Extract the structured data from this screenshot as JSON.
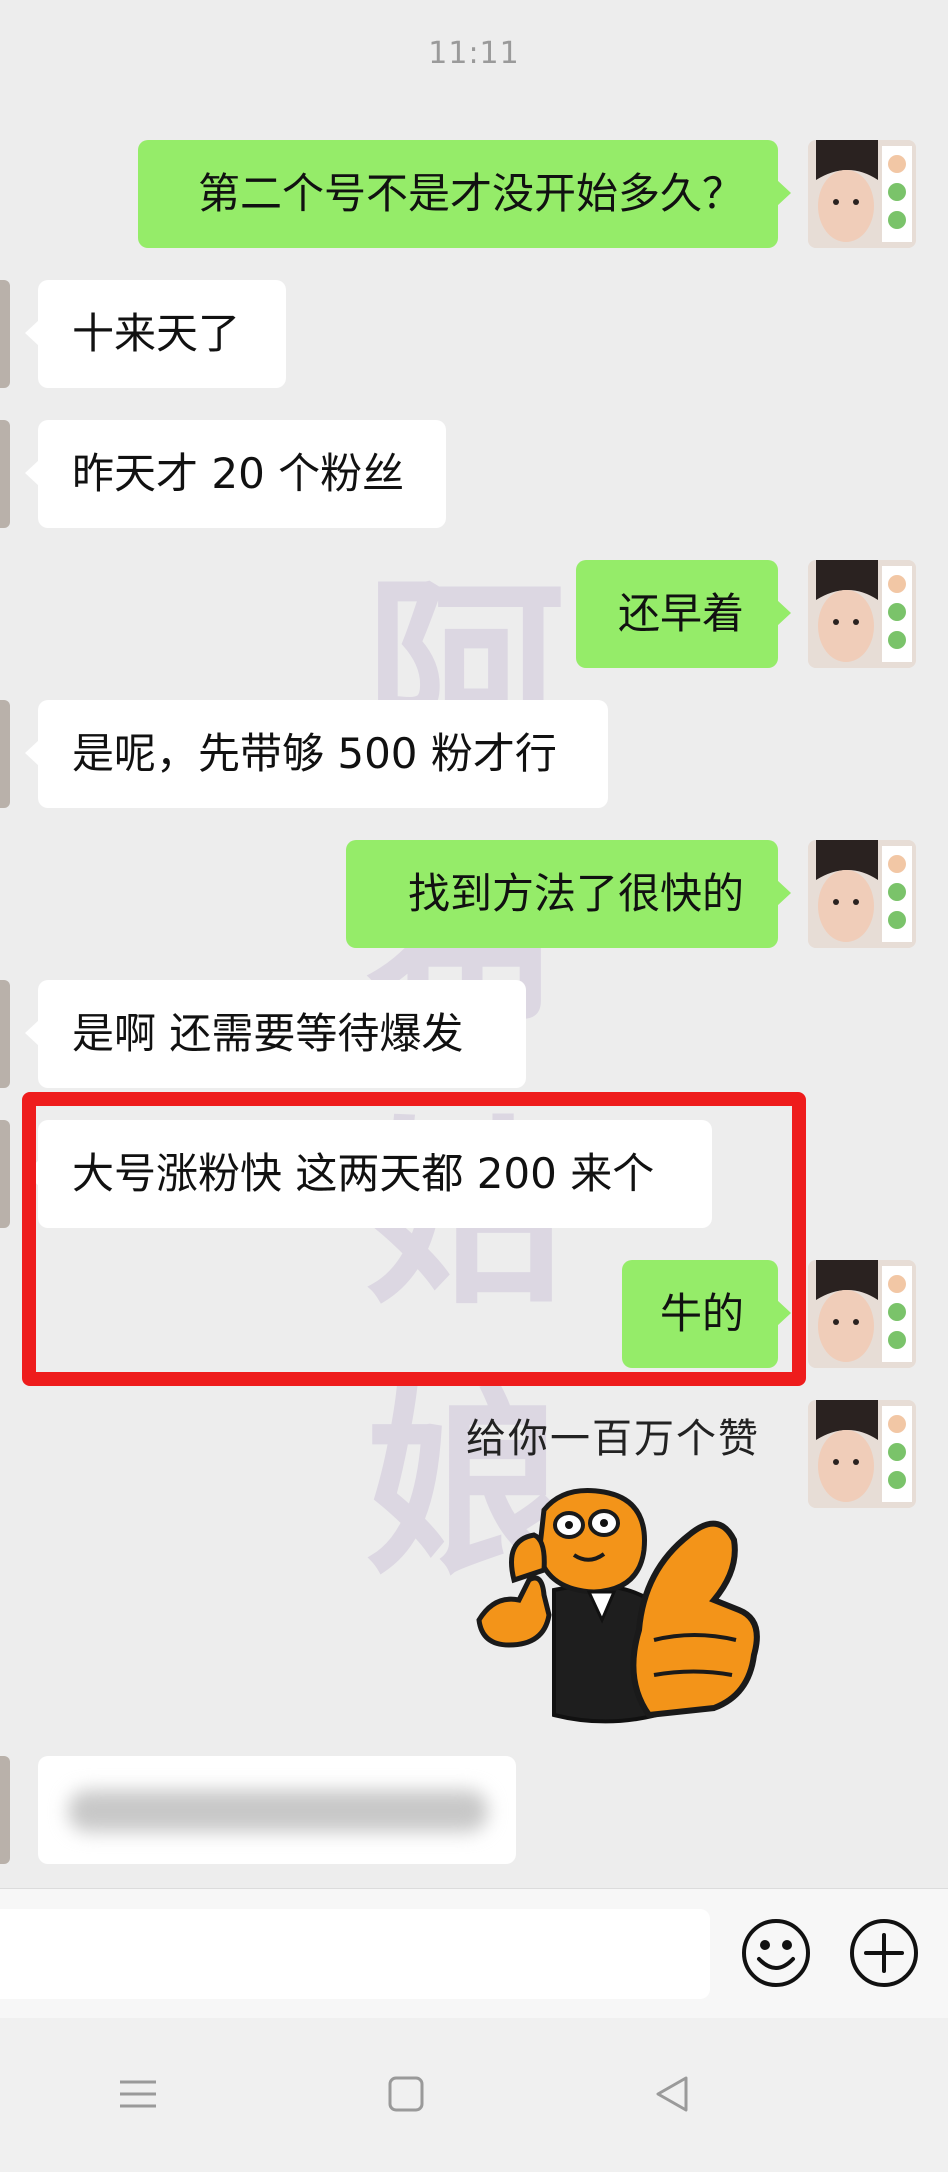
{
  "status": {
    "time": "11:11"
  },
  "watermark": [
    "阿",
    "希",
    "姑",
    "娘"
  ],
  "messages": [
    {
      "side": "out",
      "text": "第二个号不是才没开始多久？"
    },
    {
      "side": "in",
      "text": "十来天了"
    },
    {
      "side": "in",
      "text": "昨天才 20 个粉丝"
    },
    {
      "side": "out",
      "text": "还早着"
    },
    {
      "side": "in",
      "text": "是呢，先带够 500 粉才行"
    },
    {
      "side": "out",
      "text": "找到方法了很快的"
    },
    {
      "side": "in",
      "text": "是啊 还需要等待爆发"
    },
    {
      "side": "in",
      "text": "大号涨粉快 这两天都 200 来个"
    },
    {
      "side": "out",
      "text": "牛的"
    }
  ],
  "sticker": {
    "caption": "给你一百万个赞",
    "icon": "thumbs-up-bear-sticker"
  },
  "blurred_message": {
    "side": "in",
    "state": "blurred"
  },
  "input_bar": {
    "emoji_icon": "emoji-icon",
    "plus_icon": "plus-icon"
  },
  "nav_bar": {
    "icons": [
      "menu-icon",
      "home-icon",
      "back-icon"
    ]
  },
  "colors": {
    "outgoing": "#95ec69",
    "incoming": "#ffffff",
    "background": "#ededed",
    "highlight": "#ee1c1c"
  }
}
